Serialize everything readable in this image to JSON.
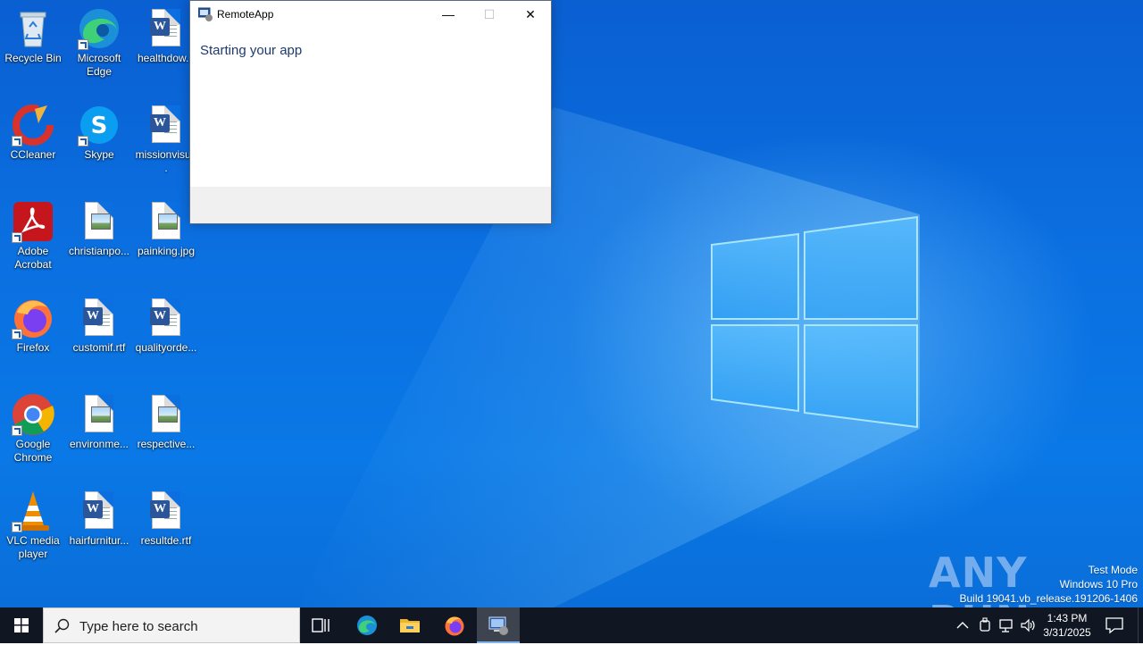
{
  "desktop": {
    "icons": [
      {
        "label": "Recycle Bin"
      },
      {
        "label": "Microsoft Edge"
      },
      {
        "label": "healthdow..."
      },
      {
        "label": "CCleaner"
      },
      {
        "label": "Skype"
      },
      {
        "label": "missionvisu..."
      },
      {
        "label": "Adobe Acrobat"
      },
      {
        "label": "christianpo..."
      },
      {
        "label": "painking.jpg"
      },
      {
        "label": "Firefox"
      },
      {
        "label": "customif.rtf"
      },
      {
        "label": "qualityorde..."
      },
      {
        "label": "Google Chrome"
      },
      {
        "label": "environme..."
      },
      {
        "label": "respective..."
      },
      {
        "label": "VLC media player"
      },
      {
        "label": "hairfurnitur..."
      },
      {
        "label": "resultde.rtf"
      }
    ]
  },
  "window": {
    "title": "RemoteApp",
    "message": "Starting your app",
    "minimize_glyph": "—",
    "maximize_glyph": "☐",
    "close_glyph": "✕"
  },
  "watermark": {
    "brand": "ANY RUN",
    "line1": "Test Mode",
    "line2": "Windows 10 Pro",
    "line3": "Build 19041.vb_release.191206-1406"
  },
  "taskbar": {
    "search_placeholder": "Type here to search",
    "items": [
      "Task View",
      "Microsoft Edge",
      "File Explorer",
      "Firefox",
      "RemoteApp"
    ],
    "clock_time": "1:43 PM",
    "clock_date": "3/31/2025"
  },
  "colors": {
    "wallpaper": "#0b6fe0",
    "taskbar": "#101723",
    "accent": "#2b579a"
  }
}
